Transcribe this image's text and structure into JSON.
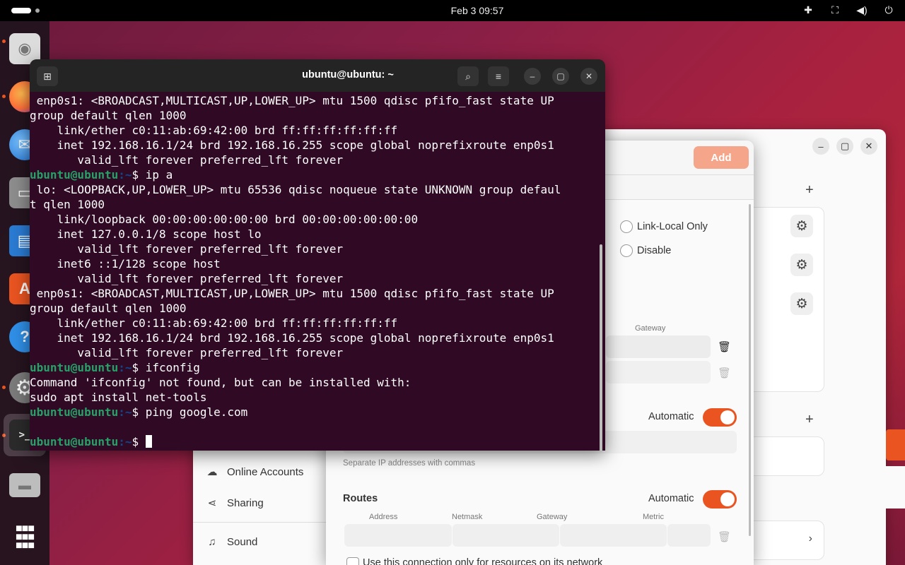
{
  "topbar": {
    "clock": "Feb 3  09:57"
  },
  "dock": {
    "apps": [
      {
        "name": "disks",
        "glyph": "◉",
        "color": "#dcdcdc"
      },
      {
        "name": "firefox",
        "glyph": "●",
        "color": "#ff7139"
      },
      {
        "name": "thunderbird",
        "glyph": "✉",
        "color": "#1d6fd1"
      },
      {
        "name": "files",
        "glyph": "▭",
        "color": "#9a9a9a"
      },
      {
        "name": "writer",
        "glyph": "▤",
        "color": "#2a7bd3"
      },
      {
        "name": "app-center",
        "glyph": "A",
        "color": "#e95420"
      },
      {
        "name": "help",
        "glyph": "?",
        "color": "#2f8fe6"
      },
      {
        "name": "settings",
        "glyph": "⚙",
        "color": "#888888"
      },
      {
        "name": "terminal",
        "glyph": ">_",
        "color": "#2b2b2b"
      },
      {
        "name": "drive",
        "glyph": "▬",
        "color": "#bdbdbd"
      },
      {
        "name": "show-apps",
        "glyph": "⋮⋮⋮",
        "color": "transparent"
      }
    ]
  },
  "terminal": {
    "title": "ubuntu@ubuntu: ~",
    "lines": [
      {
        "type": "out",
        "text": " enp0s1: <BROADCAST,MULTICAST,UP,LOWER_UP> mtu 1500 qdisc pfifo_fast state UP"
      },
      {
        "type": "out",
        "text": "group default qlen 1000"
      },
      {
        "type": "out",
        "text": "    link/ether c0:11:ab:69:42:00 brd ff:ff:ff:ff:ff:ff"
      },
      {
        "type": "out",
        "text": "    inet 192.168.16.1/24 brd 192.168.16.255 scope global noprefixroute enp0s1"
      },
      {
        "type": "out",
        "text": "       valid_lft forever preferred_lft forever"
      },
      {
        "type": "prompt",
        "user": "ubuntu@ubuntu",
        "path": ":~",
        "cmd": "$ ip a"
      },
      {
        "type": "out",
        "text": " lo: <LOOPBACK,UP,LOWER_UP> mtu 65536 qdisc noqueue state UNKNOWN group defaul"
      },
      {
        "type": "out",
        "text": "t qlen 1000"
      },
      {
        "type": "out",
        "text": "    link/loopback 00:00:00:00:00:00 brd 00:00:00:00:00:00"
      },
      {
        "type": "out",
        "text": "    inet 127.0.0.1/8 scope host lo"
      },
      {
        "type": "out",
        "text": "       valid_lft forever preferred_lft forever"
      },
      {
        "type": "out",
        "text": "    inet6 ::1/128 scope host"
      },
      {
        "type": "out",
        "text": "       valid_lft forever preferred_lft forever"
      },
      {
        "type": "out",
        "text": " enp0s1: <BROADCAST,MULTICAST,UP,LOWER_UP> mtu 1500 qdisc pfifo_fast state UP"
      },
      {
        "type": "out",
        "text": "group default qlen 1000"
      },
      {
        "type": "out",
        "text": "    link/ether c0:11:ab:69:42:00 brd ff:ff:ff:ff:ff:ff"
      },
      {
        "type": "out",
        "text": "    inet 192.168.16.1/24 brd 192.168.16.255 scope global noprefixroute enp0s1"
      },
      {
        "type": "out",
        "text": "       valid_lft forever preferred_lft forever"
      },
      {
        "type": "prompt",
        "user": "ubuntu@ubuntu",
        "path": ":~",
        "cmd": "$ ifconfig"
      },
      {
        "type": "out",
        "text": "Command 'ifconfig' not found, but can be installed with:"
      },
      {
        "type": "out",
        "text": "sudo apt install net-tools"
      },
      {
        "type": "prompt",
        "user": "ubuntu@ubuntu",
        "path": ":~",
        "cmd": "$ ping google.com"
      },
      {
        "type": "out",
        "text": ""
      },
      {
        "type": "prompt",
        "user": "ubuntu@ubuntu",
        "path": ":~",
        "cmd": "$ "
      }
    ]
  },
  "settings": {
    "sidebar": {
      "online_accounts": "Online Accounts",
      "sharing": "Sharing",
      "sound": "Sound"
    }
  },
  "dialog": {
    "add_label": "Add",
    "ipv4_methods": {
      "link_local": "Link-Local Only",
      "disable": "Disable"
    },
    "addresses": {
      "gateway_header": "Gateway"
    },
    "dns": {
      "automatic_label": "Automatic",
      "hint": "Separate IP addresses with commas"
    },
    "routes": {
      "title": "Routes",
      "automatic_label": "Automatic",
      "columns": [
        "Address",
        "Netmask",
        "Gateway",
        "Metric"
      ]
    },
    "only_resources_label": "Use this connection only for resources on its network"
  }
}
